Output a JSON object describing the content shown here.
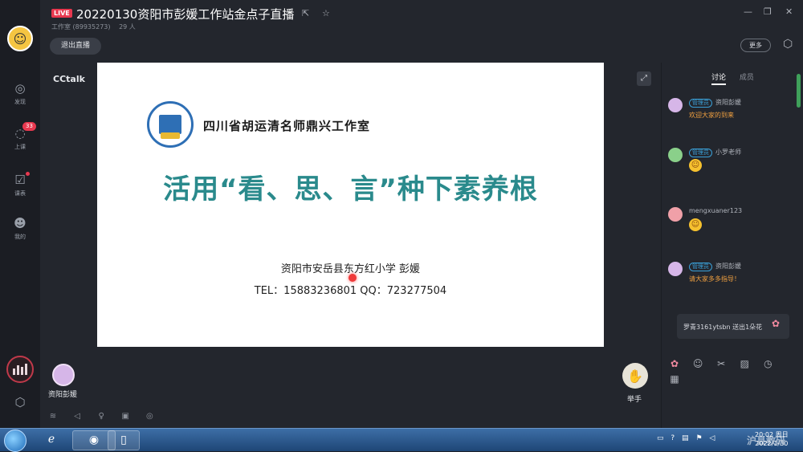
{
  "header": {
    "live_label": "LIVE",
    "title": "20220130资阳市彭媛工作站金点子直播",
    "channel": "工作室 (89935273)",
    "viewers": "29 人",
    "exit_label": "退出直播",
    "more_label": "更多"
  },
  "nav": {
    "items": [
      {
        "label": "发现",
        "icon": "compass-icon"
      },
      {
        "label": "上课",
        "icon": "chat-bubble-icon",
        "badge": "33"
      },
      {
        "label": "课表",
        "icon": "calendar-check-icon"
      },
      {
        "label": "我的",
        "icon": "person-icon"
      }
    ]
  },
  "stage": {
    "brand": "CCtalk"
  },
  "slide": {
    "org_name": "四川省胡运清名师鼎兴工作室",
    "title": "活用“看、思、言”种下素养根",
    "author": "资阳市安岳县东方红小学  彭媛",
    "contact": "TEL：15883236801   QQ：723277504"
  },
  "bottom": {
    "presenter_name": "资阳彭媛",
    "raise_hand_label": "举手"
  },
  "chat": {
    "tabs": [
      {
        "label": "讨论",
        "active": true
      },
      {
        "label": "成员",
        "active": false
      }
    ],
    "messages": [
      {
        "role": "管理员",
        "user": "资阳彭媛",
        "text": "欢迎大家的到来",
        "emoji": false
      },
      {
        "role": "管理员",
        "user": "小罗老师",
        "text": "",
        "emoji": true
      },
      {
        "role": "",
        "user": "mengxuaner123",
        "text": "",
        "emoji": true
      },
      {
        "role": "管理员",
        "user": "资阳彭媛",
        "text": "请大家多多指导！",
        "emoji": false
      }
    ],
    "gift_toast": "罗青3161ytsbn 送出1朵花"
  },
  "taskbar": {
    "clock_time": "20:02 周日",
    "clock_date": "2022/1/30"
  },
  "watermark": "沪县教研"
}
